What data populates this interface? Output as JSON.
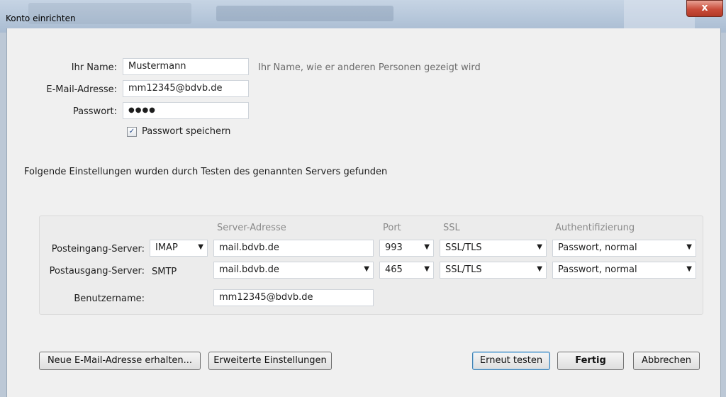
{
  "window": {
    "title": "Konto einrichten",
    "close_glyph": "x"
  },
  "form": {
    "name_label": "Ihr Name:",
    "name_value": "Mustermann",
    "name_hint": "Ihr Name, wie er anderen Personen gezeigt wird",
    "email_label": "E-Mail-Adresse:",
    "email_value": "mm12345@bdvb.de",
    "password_label": "Passwort:",
    "password_value": "●●●●",
    "remember_label": "Passwort speichern",
    "remember_checked": true,
    "checkmark": "✓"
  },
  "info_text": "Folgende Einstellungen wurden durch Testen des genannten Servers gefunden",
  "server_table": {
    "headers": {
      "address": "Server-Adresse",
      "port": "Port",
      "ssl": "SSL",
      "auth": "Authentifizierung"
    },
    "incoming": {
      "label": "Posteingang-Server:",
      "protocol": "IMAP",
      "address": "mail.bdvb.de",
      "port": "993",
      "ssl": "SSL/TLS",
      "auth": "Passwort, normal"
    },
    "outgoing": {
      "label": "Postausgang-Server:",
      "protocol": "SMTP",
      "address": "mail.bdvb.de",
      "port": "465",
      "ssl": "SSL/TLS",
      "auth": "Passwort, normal"
    },
    "username": {
      "label": "Benutzername:",
      "value": "mm12345@bdvb.de"
    },
    "dropdown_arrow": "▼"
  },
  "buttons": {
    "new_address": "Neue E-Mail-Adresse erhalten...",
    "advanced": "Erweiterte Einstellungen",
    "retest": "Erneut testen",
    "done": "Fertig",
    "cancel": "Abbrechen"
  },
  "colors": {
    "dialog_bg": "#f0f0f0",
    "close_button": "#c94d3a",
    "focus_border": "#3c7fb1"
  }
}
